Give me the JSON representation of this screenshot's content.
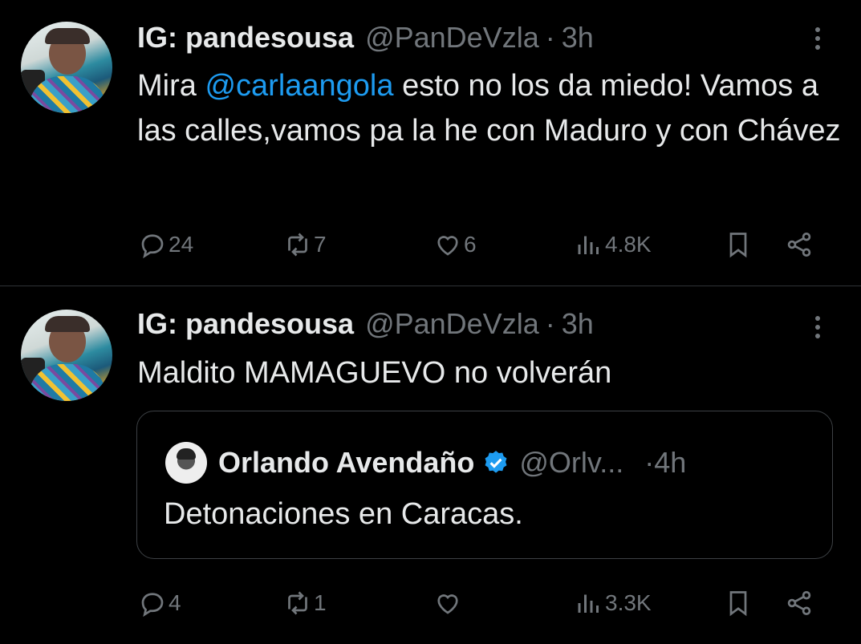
{
  "tweets": [
    {
      "name": "IG: pandesousa",
      "handle": "@PanDeVzla",
      "dot": "·",
      "time": "3h",
      "text_prefix": "Mira ",
      "mention": "@carlaangola",
      "text_suffix": " esto no los da miedo! Vamos a las calles,vamos pa la he con Maduro y con Chávez",
      "replies": "24",
      "reposts": "7",
      "likes": "6",
      "views": "4.8K"
    },
    {
      "name": "IG: pandesousa",
      "handle": "@PanDeVzla",
      "dot": "·",
      "time": "3h",
      "text": "Maldito MAMAGUEVO no volverán",
      "quote": {
        "name": "Orlando Avendaño",
        "handle": "@Orlv...",
        "dot": "·",
        "time": "4h",
        "text": "Detonaciones en Caracas."
      },
      "replies": "4",
      "reposts": "1",
      "likes": "",
      "views": "3.3K"
    }
  ],
  "colors": {
    "background": "#000000",
    "text": "#e7e9ea",
    "muted": "#71767b",
    "accent": "#1d9bf0",
    "border": "#2f3336"
  },
  "icons": {
    "reply": "speech-bubble-icon",
    "repost": "repost-arrows-icon",
    "like": "heart-icon",
    "views": "bar-chart-icon",
    "bookmark": "bookmark-icon",
    "share": "share-icon",
    "more": "vertical-ellipsis-icon",
    "verified": "verified-badge-icon"
  }
}
